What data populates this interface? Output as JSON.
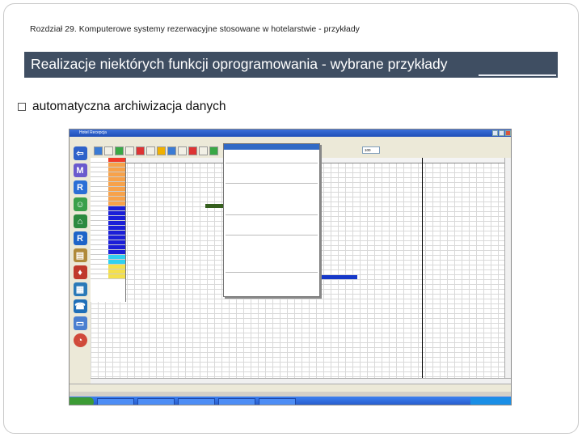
{
  "slide": {
    "chapter": "Rozdział 29. Komputerowe systemy rezerwacyjne stosowane w hotelarstwie - przykłady",
    "title": "Realizacje niektórych funkcji oprogramowania - wybrane przykłady",
    "bullet": "automatyczna archiwizacja danych"
  },
  "screenshot": {
    "window_title": "Hotel Recepcja",
    "zoom": "100"
  },
  "colors": {
    "title_bar_bg": "#3f4e62",
    "booking_blue": "#1538c8",
    "menu_highlight": "#316ac5"
  }
}
